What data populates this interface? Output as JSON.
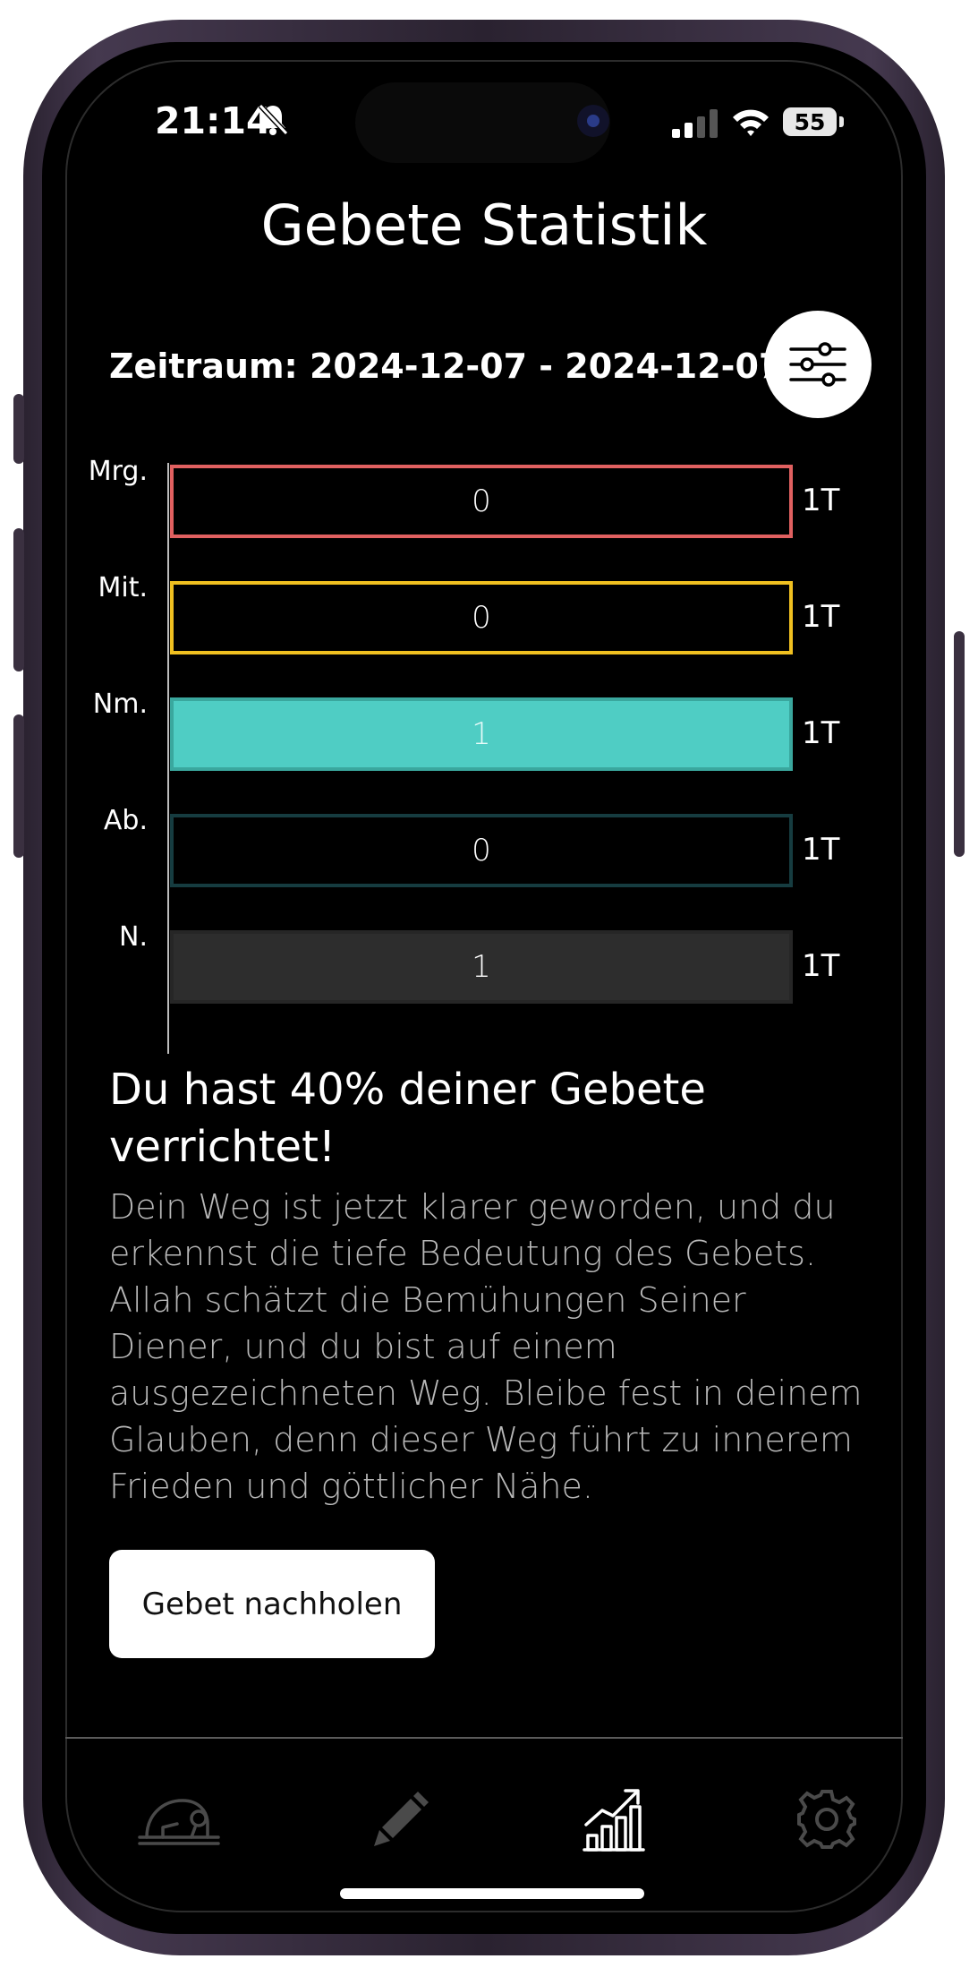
{
  "status_bar": {
    "time": "21:14",
    "battery": "55"
  },
  "header": {
    "title": "Gebete Statistik"
  },
  "period": {
    "label": "Zeitraum: 2024-12-07 - 2024-12-07"
  },
  "chart_data": {
    "type": "bar",
    "orientation": "horizontal",
    "categories": [
      "Mrg.",
      "Mit.",
      "Nm.",
      "Ab.",
      "N."
    ],
    "values": [
      0,
      0,
      1,
      0,
      1
    ],
    "end_labels": [
      "1T",
      "1T",
      "1T",
      "1T",
      "1T"
    ],
    "colors": [
      "#e06060",
      "#f0c020",
      "#4fcdc4",
      "#163c40",
      "#2d2d2d"
    ]
  },
  "summary": {
    "headline": "Du hast 40% deiner Gebete verrichtet!",
    "text": "Dein Weg ist jetzt klarer geworden, und du erkennst die tiefe Bedeutung des Gebets. Allah schätzt die Bemühungen Seiner Diener, und du bist auf einem ausgezeichneten Weg. Bleibe fest in deinem Glauben, denn dieser Weg führt zu innerem Frieden und göttlicher Nähe."
  },
  "actions": {
    "makeup_label": "Gebet nachholen"
  },
  "tabbar": {
    "items": [
      {
        "icon": "prayer-icon",
        "active": false
      },
      {
        "icon": "pencil-icon",
        "active": false
      },
      {
        "icon": "chart-icon",
        "active": true
      },
      {
        "icon": "gear-icon",
        "active": false
      }
    ]
  }
}
